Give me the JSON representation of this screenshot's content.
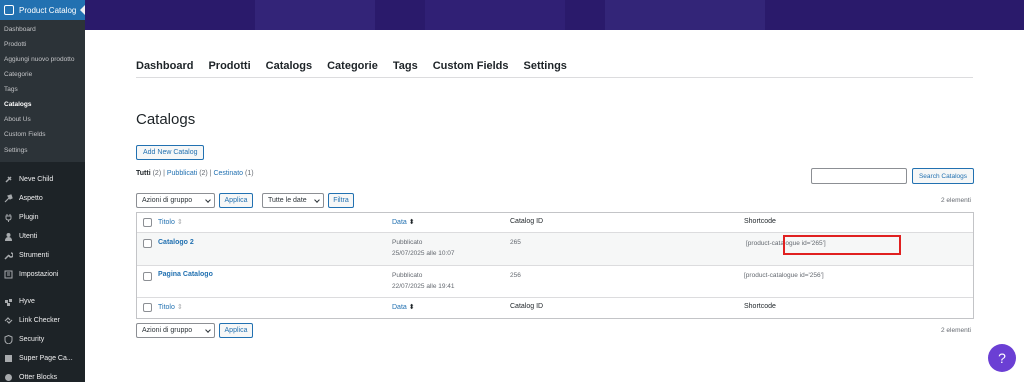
{
  "sidebar": {
    "current": "Product Catalog",
    "sub_items": [
      "Dashboard",
      "Prodotti",
      "Aggiungi nuovo prodotto",
      "Categorie",
      "Tags",
      "Catalogs",
      "About Us",
      "Custom Fields",
      "Settings"
    ],
    "menu_group1": [
      "Neve Child",
      "Aspetto",
      "Plugin",
      "Utenti",
      "Strumenti",
      "Impostazioni"
    ],
    "menu_group2": [
      "Hyve",
      "Link Checker",
      "Security",
      "Super Page Ca...",
      "Otter Blocks"
    ]
  },
  "tabs": [
    "Dashboard",
    "Prodotti",
    "Catalogs",
    "Categorie",
    "Tags",
    "Custom Fields",
    "Settings"
  ],
  "page_title": "Catalogs",
  "add_button": "Add New Catalog",
  "views": {
    "all": "Tutti",
    "all_count": "(2)",
    "published": "Pubblicati",
    "published_count": "(2)",
    "trash": "Cestinato",
    "trash_count": "(1)"
  },
  "search_button": "Search Catalogs",
  "bulk_action": "Azioni di gruppo",
  "apply": "Applica",
  "date_filter": "Tutte le date",
  "filter": "Filtra",
  "item_count": "2 elementi",
  "columns": {
    "title": "Titolo",
    "date": "Data",
    "catalog_id": "Catalog ID",
    "shortcode": "Shortcode"
  },
  "rows": [
    {
      "title": "Catalogo 2",
      "status": "Pubblicato",
      "date": "25/07/2025 alle 10:07",
      "id": "265",
      "shortcode": "[product-catalogue id='265']"
    },
    {
      "title": "Pagina Catalogo",
      "status": "Pubblicato",
      "date": "22/07/2025 alle 19:41",
      "id": "256",
      "shortcode": "[product-catalogue id='256']"
    }
  ],
  "help": "?"
}
